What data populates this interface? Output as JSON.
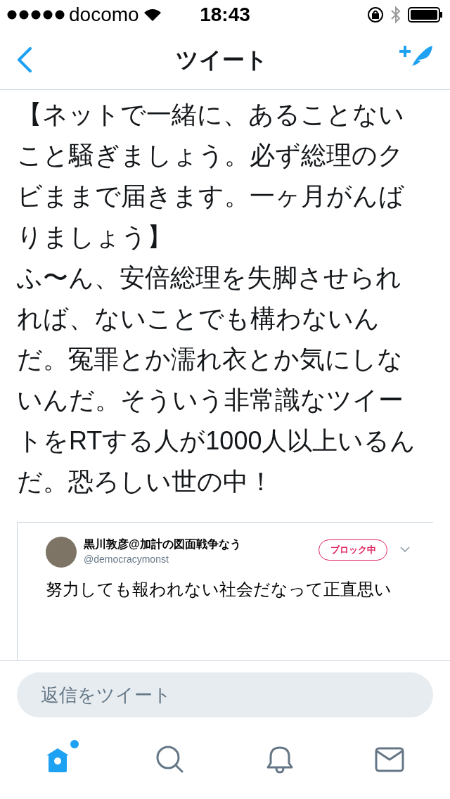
{
  "status_bar": {
    "carrier": "docomo",
    "time": "18:43"
  },
  "nav": {
    "title": "ツイート"
  },
  "tweet": {
    "paragraphs": [
      "【ネットで一緒に、あることないこと騒ぎましょう。必ず総理のクビままで届きます。一ヶ月がんばりましょう】",
      "ふ〜ん、安倍総理を失脚させられれば、ないことでも構わないんだ。冤罪とか濡れ衣とか気にしないんだ。そういう非常識なツイートをRTする人が1000人以上いるんだ。恐ろしい世の中！"
    ]
  },
  "quoted": {
    "name": "黒川敦彦@加計の図面戦争なう",
    "handle": "@democracymonst",
    "status": "ブロック中",
    "text": "努力しても報われない社会だなって正直思い"
  },
  "reply": {
    "placeholder": "返信をツイート"
  },
  "tabs": [
    {
      "kind": "home",
      "selected": true,
      "has_new": true
    },
    {
      "kind": "search",
      "selected": false,
      "has_new": false
    },
    {
      "kind": "notifications",
      "selected": false,
      "has_new": false
    },
    {
      "kind": "messages",
      "selected": false,
      "has_new": false
    }
  ]
}
